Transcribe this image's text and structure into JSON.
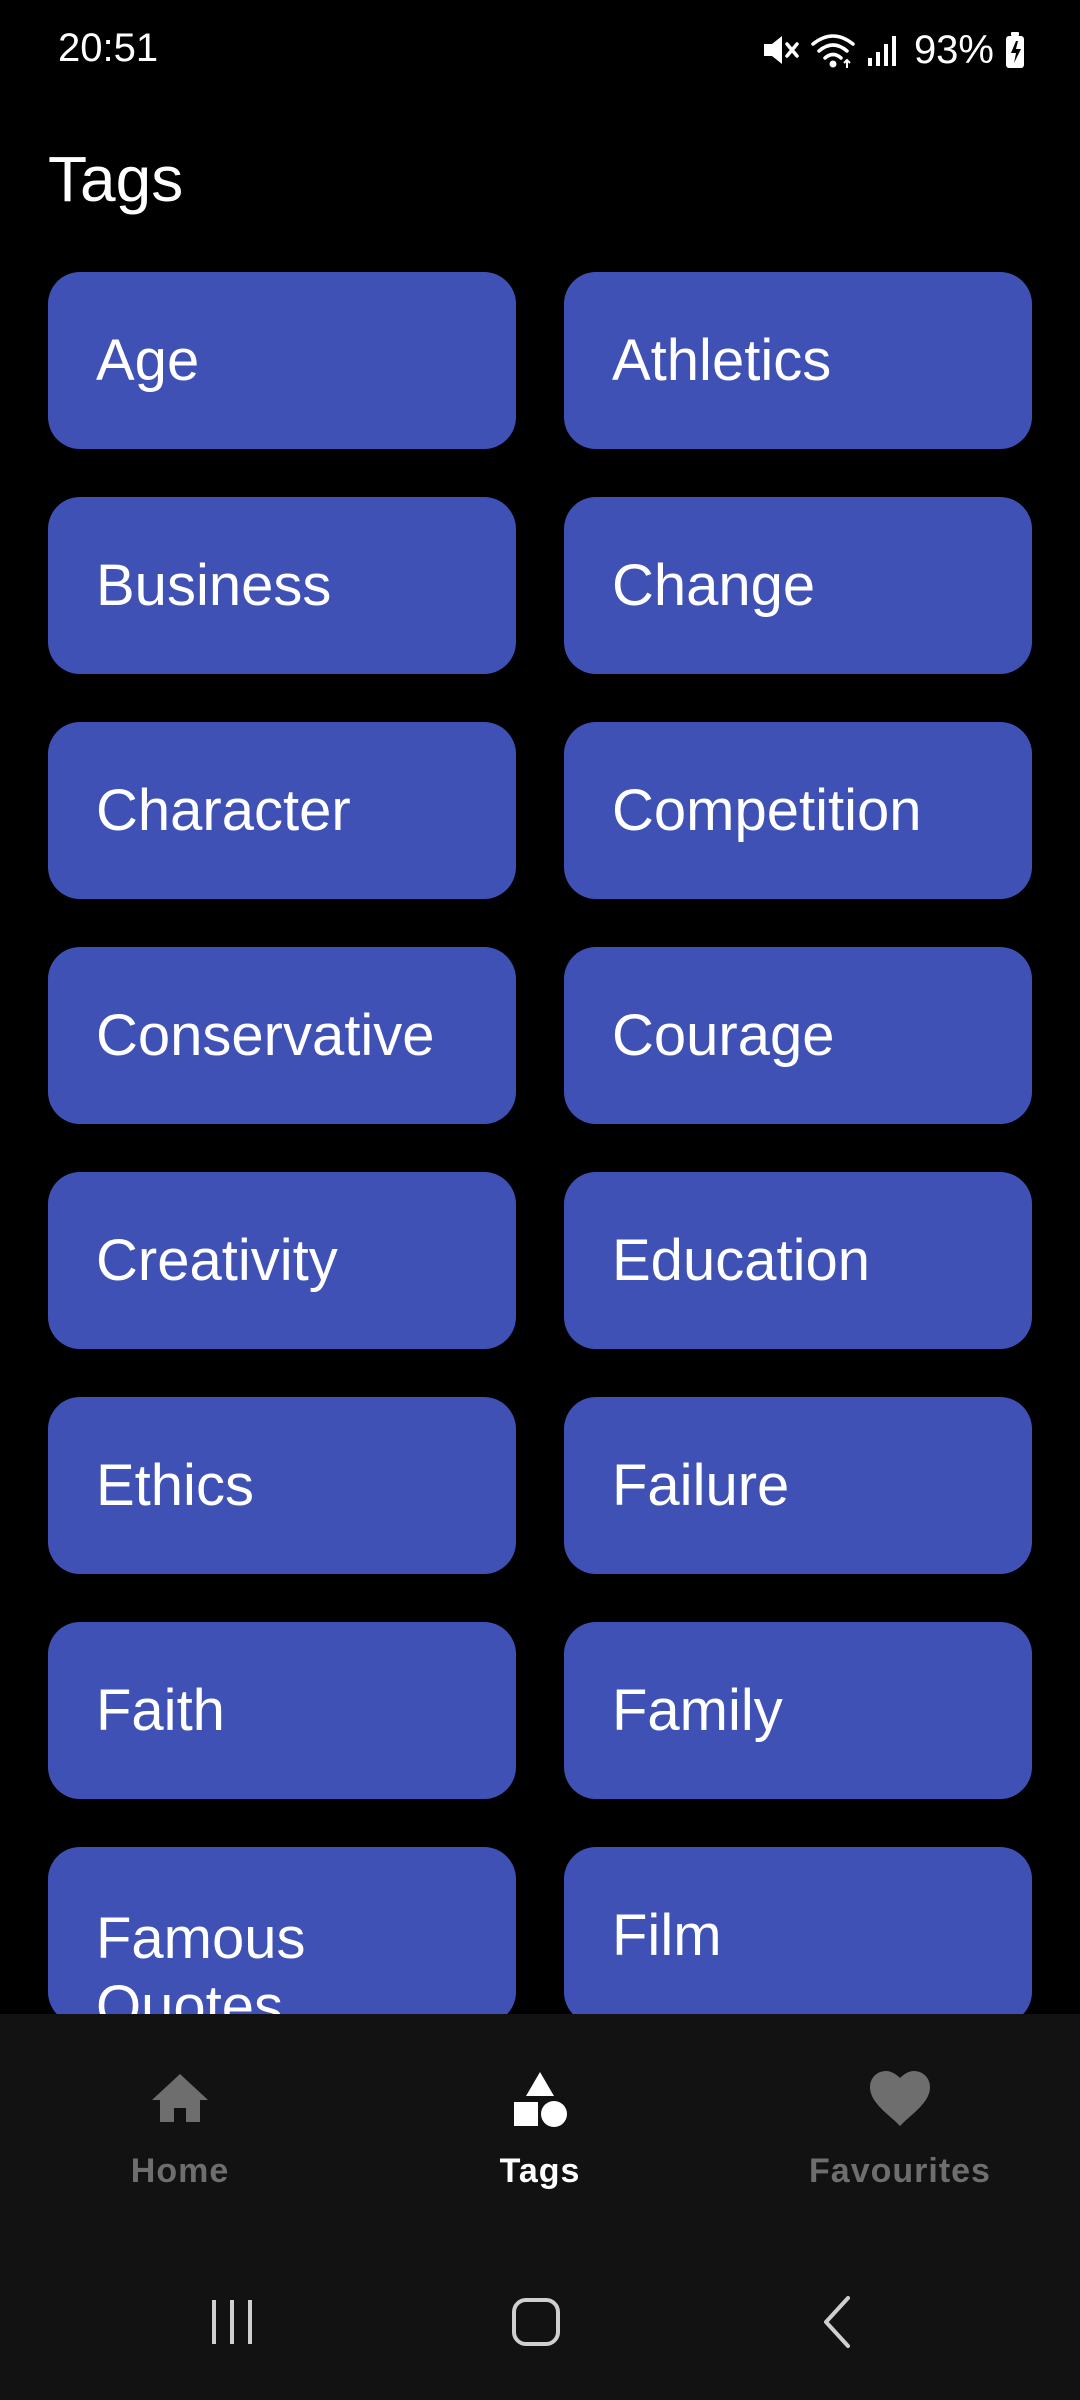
{
  "status_bar": {
    "time": "20:51",
    "battery": "93%",
    "icons": [
      "mute-icon",
      "wifi-icon",
      "signal-icon",
      "battery-charging-icon"
    ]
  },
  "page": {
    "title": "Tags"
  },
  "tags": [
    "Age",
    "Athletics",
    "Business",
    "Change",
    "Character",
    "Competition",
    "Conservative",
    "Courage",
    "Creativity",
    "Education",
    "Ethics",
    "Failure",
    "Faith",
    "Family",
    "Famous Quotes",
    "Film"
  ],
  "bottom_nav": {
    "home": "Home",
    "tags": "Tags",
    "favourites": "Favourites",
    "active": "tags"
  },
  "system_nav": {
    "icons": [
      "recent-apps-icon",
      "home-icon",
      "back-icon"
    ]
  },
  "colors": {
    "background": "#000000",
    "tag_card": "#3f51b5",
    "nav_background": "#121212",
    "nav_inactive": "#6e6e6e",
    "nav_active": "#ffffff"
  }
}
